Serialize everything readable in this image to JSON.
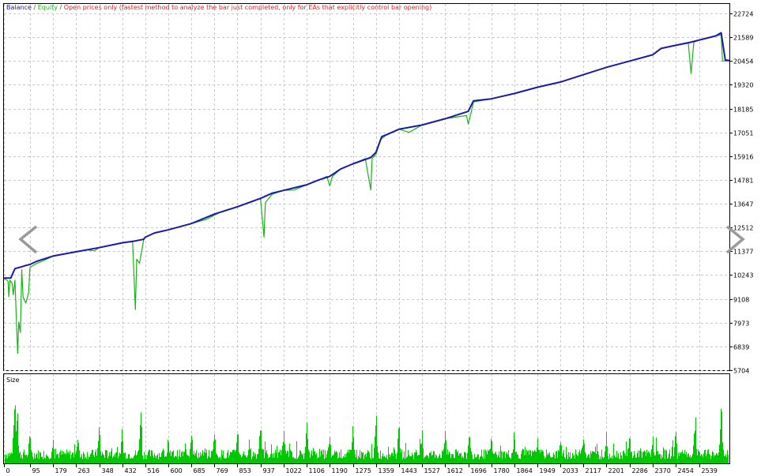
{
  "legend": {
    "balance": "Balance",
    "sep1": " / ",
    "equity": "Equity",
    "sep2": " / ",
    "mode": "Open prices only (fastest method to analyze the bar just completed, only for EAs that explicitly control bar opening)"
  },
  "size_label": "Size",
  "colors": {
    "balance": "#1a1aa6",
    "equity": "#16b516",
    "mode": "#e02020",
    "grid": "#c8c8c8",
    "axis": "#000000",
    "arrow": "#9a9a9a",
    "volume": "#00c800"
  },
  "nav": {
    "prev": "chevron-left-icon",
    "next": "chevron-right-icon"
  },
  "chart_data": [
    {
      "type": "line",
      "yticks": [
        22724,
        21589,
        20454,
        19320,
        18185,
        17051,
        15916,
        14781,
        13647,
        12512,
        11377,
        10243,
        9108,
        7973,
        6839,
        5704
      ],
      "ylim": [
        5704,
        23174
      ],
      "xlim": [
        0,
        2650
      ],
      "grid": true,
      "series": [
        {
          "name": "Balance",
          "points": [
            [
              0,
              10100
            ],
            [
              25,
              10100
            ],
            [
              40,
              10550
            ],
            [
              60,
              10620
            ],
            [
              80,
              10700
            ],
            [
              95,
              10750
            ],
            [
              120,
              10900
            ],
            [
              179,
              11150
            ],
            [
              263,
              11350
            ],
            [
              348,
              11550
            ],
            [
              432,
              11780
            ],
            [
              480,
              11870
            ],
            [
              510,
              11950
            ],
            [
              516,
              12050
            ],
            [
              550,
              12250
            ],
            [
              600,
              12400
            ],
            [
              685,
              12700
            ],
            [
              769,
              13150
            ],
            [
              853,
              13500
            ],
            [
              937,
              13900
            ],
            [
              980,
              14150
            ],
            [
              1022,
              14280
            ],
            [
              1106,
              14550
            ],
            [
              1150,
              14780
            ],
            [
              1190,
              14950
            ],
            [
              1230,
              15300
            ],
            [
              1275,
              15550
            ],
            [
              1340,
              15850
            ],
            [
              1359,
              16100
            ],
            [
              1380,
              16850
            ],
            [
              1400,
              16950
            ],
            [
              1443,
              17200
            ],
            [
              1527,
              17400
            ],
            [
              1612,
              17700
            ],
            [
              1696,
              18050
            ],
            [
              1715,
              18550
            ],
            [
              1780,
              18650
            ],
            [
              1864,
              18900
            ],
            [
              1949,
              19200
            ],
            [
              2033,
              19450
            ],
            [
              2117,
              19800
            ],
            [
              2201,
              20150
            ],
            [
              2286,
              20450
            ],
            [
              2370,
              20750
            ],
            [
              2400,
              21050
            ],
            [
              2454,
              21200
            ],
            [
              2510,
              21350
            ],
            [
              2539,
              21450
            ],
            [
              2600,
              21650
            ],
            [
              2620,
              21800
            ],
            [
              2635,
              20500
            ],
            [
              2650,
              20480
            ]
          ]
        },
        {
          "name": "Equity",
          "points": [
            [
              0,
              10100
            ],
            [
              15,
              9950
            ],
            [
              18,
              9200
            ],
            [
              22,
              10000
            ],
            [
              30,
              9850
            ],
            [
              34,
              9300
            ],
            [
              40,
              10000
            ],
            [
              50,
              6500
            ],
            [
              54,
              8000
            ],
            [
              60,
              7500
            ],
            [
              65,
              10500
            ],
            [
              70,
              9200
            ],
            [
              80,
              8900
            ],
            [
              90,
              9400
            ],
            [
              95,
              10600
            ],
            [
              100,
              10650
            ],
            [
              120,
              10800
            ],
            [
              140,
              10900
            ],
            [
              179,
              11150
            ],
            [
              200,
              11200
            ],
            [
              263,
              11350
            ],
            [
              300,
              11450
            ],
            [
              330,
              11400
            ],
            [
              348,
              11550
            ],
            [
              400,
              11700
            ],
            [
              432,
              11780
            ],
            [
              470,
              11850
            ],
            [
              480,
              8600
            ],
            [
              485,
              11000
            ],
            [
              495,
              10800
            ],
            [
              510,
              11900
            ],
            [
              516,
              12050
            ],
            [
              550,
              12250
            ],
            [
              600,
              12400
            ],
            [
              685,
              12700
            ],
            [
              740,
              12900
            ],
            [
              769,
              13100
            ],
            [
              800,
              13300
            ],
            [
              853,
              13500
            ],
            [
              900,
              13700
            ],
            [
              937,
              13900
            ],
            [
              950,
              12050
            ],
            [
              955,
              13700
            ],
            [
              980,
              14100
            ],
            [
              1022,
              14280
            ],
            [
              1060,
              14300
            ],
            [
              1106,
              14550
            ],
            [
              1150,
              14780
            ],
            [
              1180,
              14950
            ],
            [
              1190,
              14500
            ],
            [
              1200,
              14950
            ],
            [
              1230,
              15300
            ],
            [
              1275,
              15550
            ],
            [
              1320,
              15800
            ],
            [
              1340,
              14300
            ],
            [
              1345,
              15800
            ],
            [
              1359,
              16000
            ],
            [
              1375,
              16700
            ],
            [
              1400,
              16950
            ],
            [
              1443,
              17200
            ],
            [
              1480,
              17050
            ],
            [
              1527,
              17400
            ],
            [
              1612,
              17700
            ],
            [
              1690,
              17850
            ],
            [
              1696,
              17450
            ],
            [
              1705,
              17900
            ],
            [
              1715,
              18500
            ],
            [
              1780,
              18650
            ],
            [
              1864,
              18900
            ],
            [
              1949,
              19200
            ],
            [
              2033,
              19450
            ],
            [
              2117,
              19800
            ],
            [
              2201,
              20150
            ],
            [
              2286,
              20450
            ],
            [
              2370,
              20750
            ],
            [
              2400,
              21050
            ],
            [
              2454,
              21200
            ],
            [
              2500,
              21300
            ],
            [
              2510,
              19850
            ],
            [
              2520,
              21350
            ],
            [
              2539,
              21450
            ],
            [
              2600,
              21650
            ],
            [
              2620,
              21700
            ],
            [
              2625,
              20450
            ],
            [
              2650,
              20450
            ]
          ]
        }
      ]
    },
    {
      "type": "bar",
      "label": "Size",
      "xticks": [
        "0",
        "95",
        "179",
        "263",
        "348",
        "432",
        "516",
        "600",
        "685",
        "769",
        "853",
        "937",
        "1022",
        "1106",
        "1190",
        "1275",
        "1359",
        "1443",
        "1527",
        "1612",
        "1696",
        "1780",
        "1864",
        "1949",
        "2033",
        "2117",
        "2201",
        "2286",
        "2370",
        "2454",
        "2539"
      ],
      "xlim": [
        0,
        2650
      ],
      "peaks": [
        [
          40,
          1.0
        ],
        [
          48,
          0.75
        ],
        [
          95,
          0.45
        ],
        [
          180,
          0.35
        ],
        [
          270,
          0.4
        ],
        [
          348,
          0.55
        ],
        [
          432,
          0.45
        ],
        [
          500,
          0.85
        ],
        [
          600,
          0.3
        ],
        [
          685,
          0.5
        ],
        [
          769,
          0.55
        ],
        [
          853,
          0.5
        ],
        [
          937,
          0.6
        ],
        [
          1022,
          0.45
        ],
        [
          1106,
          0.55
        ],
        [
          1190,
          0.45
        ],
        [
          1275,
          0.5
        ],
        [
          1359,
          0.65
        ],
        [
          1443,
          0.55
        ],
        [
          1527,
          0.45
        ],
        [
          1612,
          0.5
        ],
        [
          1700,
          0.45
        ],
        [
          1780,
          0.4
        ],
        [
          1864,
          0.4
        ],
        [
          1949,
          0.35
        ],
        [
          2033,
          0.35
        ],
        [
          2117,
          0.45
        ],
        [
          2201,
          0.35
        ],
        [
          2286,
          0.4
        ],
        [
          2370,
          0.35
        ],
        [
          2454,
          0.45
        ],
        [
          2525,
          0.65
        ],
        [
          2620,
          0.85
        ]
      ]
    }
  ]
}
